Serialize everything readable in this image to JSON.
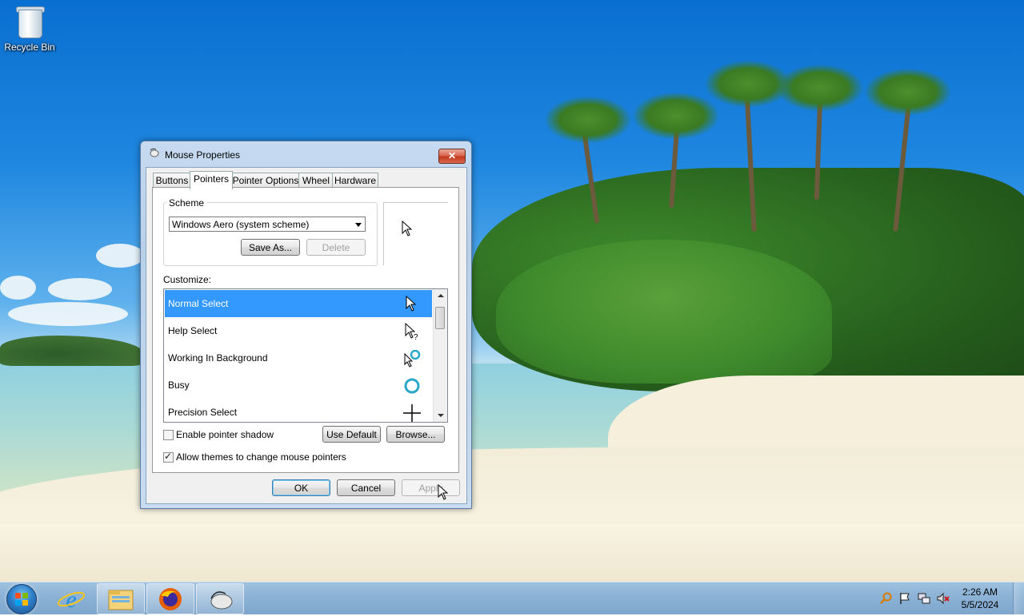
{
  "desktop": {
    "icons": [
      {
        "label": "Recycle Bin",
        "icon": "recycle-bin-icon"
      }
    ]
  },
  "window": {
    "title": "Mouse Properties",
    "close_label": "✕",
    "tabs": [
      {
        "label": "Buttons"
      },
      {
        "label": "Pointers",
        "active": true
      },
      {
        "label": "Pointer Options"
      },
      {
        "label": "Wheel"
      },
      {
        "label": "Hardware"
      }
    ],
    "scheme": {
      "group_label": "Scheme",
      "selected": "Windows Aero (system scheme)",
      "save_as_label": "Save As...",
      "delete_label": "Delete"
    },
    "customize": {
      "label": "Customize:",
      "items": [
        {
          "label": "Normal Select",
          "cursor": "arrow-cursor-icon",
          "selected": true
        },
        {
          "label": "Help Select",
          "cursor": "help-cursor-icon"
        },
        {
          "label": "Working In Background",
          "cursor": "working-cursor-icon"
        },
        {
          "label": "Busy",
          "cursor": "busy-cursor-icon"
        },
        {
          "label": "Precision Select",
          "cursor": "crosshair-cursor-icon"
        }
      ]
    },
    "enable_shadow": {
      "label": "Enable pointer shadow",
      "checked": false
    },
    "allow_themes": {
      "label": "Allow themes to change mouse pointers",
      "checked": true
    },
    "use_default_label": "Use Default",
    "browse_label": "Browse...",
    "ok_label": "OK",
    "cancel_label": "Cancel",
    "apply_label": "Apply"
  },
  "taskbar": {
    "pinned": [
      {
        "name": "internet-explorer",
        "icon": "internet-explorer-icon"
      },
      {
        "name": "file-explorer",
        "icon": "folder-icon"
      },
      {
        "name": "firefox",
        "icon": "firefox-icon"
      },
      {
        "name": "mouse-properties",
        "icon": "mouse-icon"
      }
    ],
    "time": "2:26 AM",
    "date": "5/5/2024"
  },
  "colors": {
    "selection": "#3399ff",
    "taskbar": "#8db3d6"
  }
}
